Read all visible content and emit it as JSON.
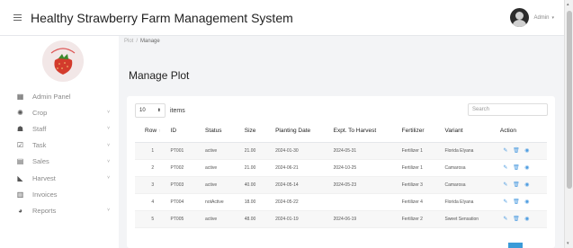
{
  "header": {
    "title": "Healthy Strawberry Farm Management System",
    "user_name": "Admin",
    "user_caret": "▾",
    "menu_icon": "hamburger-icon"
  },
  "sidebar": {
    "logo_icon": "strawberry-logo",
    "items": [
      {
        "label": "Admin Panel",
        "icon": "grid-icon",
        "glyph": "▦",
        "has_caret": false
      },
      {
        "label": "Crop",
        "icon": "crop-icon",
        "glyph": "✺",
        "has_caret": true
      },
      {
        "label": "Staff",
        "icon": "staff-icon",
        "glyph": "☗",
        "has_caret": true
      },
      {
        "label": "Task",
        "icon": "task-icon",
        "glyph": "☑",
        "has_caret": true
      },
      {
        "label": "Sales",
        "icon": "sales-icon",
        "glyph": "▤",
        "has_caret": true
      },
      {
        "label": "Harvest",
        "icon": "harvest-icon",
        "glyph": "◣",
        "has_caret": true
      },
      {
        "label": "Invoices",
        "icon": "invoice-icon",
        "glyph": "▥",
        "has_caret": false
      },
      {
        "label": "Reports",
        "icon": "reports-icon",
        "glyph": "◕",
        "has_caret": true
      }
    ],
    "caret": "˅"
  },
  "breadcrumb": {
    "root": "Plot",
    "sep": "/",
    "current": "Manage"
  },
  "page": {
    "title": "Manage Plot"
  },
  "table_controls": {
    "page_size": "10",
    "page_size_arrows": "⬍",
    "items_label": "items",
    "search_placeholder": "Search"
  },
  "table": {
    "columns": [
      "Row",
      "ID",
      "Status",
      "Size",
      "Planting Date",
      "Expt. To Harvest",
      "Fertilizer",
      "Variant",
      "Action"
    ],
    "sort_indicator": "↑",
    "rows": [
      {
        "row": "1",
        "id": "PT001",
        "status": "active",
        "size": "21.00",
        "planting_date": "2024-01-30",
        "harvest": "2024-05-31",
        "fertilizer": "Fertilizer 1",
        "variant": "Florida Elyana"
      },
      {
        "row": "2",
        "id": "PT002",
        "status": "active",
        "size": "21.00",
        "planting_date": "2024-06-21",
        "harvest": "2024-10-25",
        "fertilizer": "Fertilizer 1",
        "variant": "Camarosa"
      },
      {
        "row": "3",
        "id": "PT003",
        "status": "active",
        "size": "40.00",
        "planting_date": "2024-05-14",
        "harvest": "2024-05-23",
        "fertilizer": "Fertilizer 3",
        "variant": "Camarosa"
      },
      {
        "row": "4",
        "id": "PT004",
        "status": "notActive",
        "size": "18.00",
        "planting_date": "2024-05-22",
        "harvest": "",
        "fertilizer": "Fertilizer 4",
        "variant": "Florida Elyana"
      },
      {
        "row": "5",
        "id": "PT005",
        "status": "active",
        "size": "48.00",
        "planting_date": "2024-01-19",
        "harvest": "2024-06-19",
        "fertilizer": "Fertilizer 2",
        "variant": "Sweet Sensation"
      }
    ],
    "action_icons": {
      "edit": "✎",
      "delete": "🗑",
      "view": "◉"
    }
  },
  "scrollbar": {
    "up": "▴",
    "down": "▾"
  },
  "colors": {
    "accent": "#4b9be0",
    "pager": "#3b9bd8"
  }
}
